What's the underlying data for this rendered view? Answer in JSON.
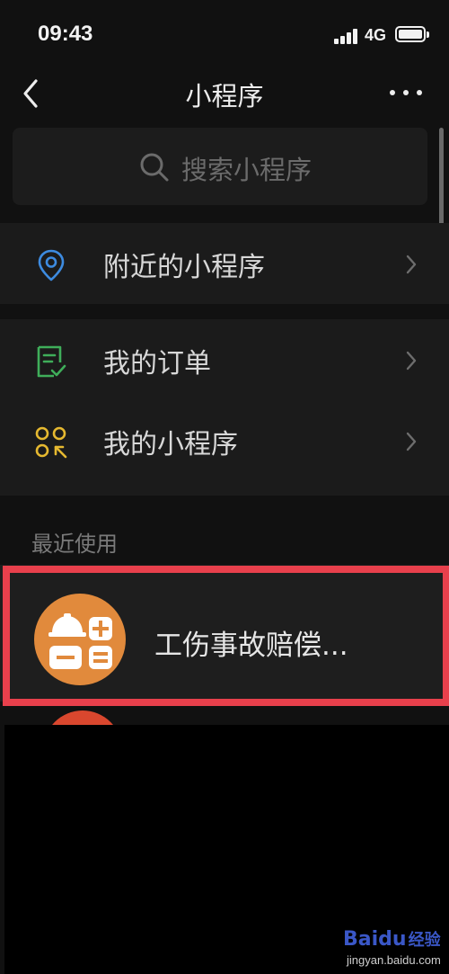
{
  "status_bar": {
    "time": "09:43",
    "network": "4G"
  },
  "nav": {
    "title": "小程序",
    "back_icon": "chevron-left-icon",
    "more_icon": "more-icon"
  },
  "search": {
    "placeholder": "搜索小程序"
  },
  "menu": {
    "nearby": {
      "label": "附近的小程序",
      "icon": "location-pin-icon"
    },
    "orders": {
      "label": "我的订单",
      "icon": "order-list-icon"
    },
    "my_mini": {
      "label": "我的小程序",
      "icon": "mini-program-icon"
    }
  },
  "recent": {
    "title": "最近使用",
    "items": [
      {
        "name": "工伤事故赔偿...",
        "icon": "calculator-helmet-icon"
      }
    ]
  },
  "watermark": {
    "logo_a": "Bai",
    "logo_b": "du",
    "cn": "经验",
    "url": "jingyan.baidu.com"
  },
  "colors": {
    "background": "#111111",
    "card": "#1b1b1b",
    "highlight": "#e8404c",
    "app_icon": "#e18a3c",
    "nearby_icon": "#3d8be0",
    "orders_icon": "#3fae5a",
    "mini_icon": "#e6b930"
  }
}
